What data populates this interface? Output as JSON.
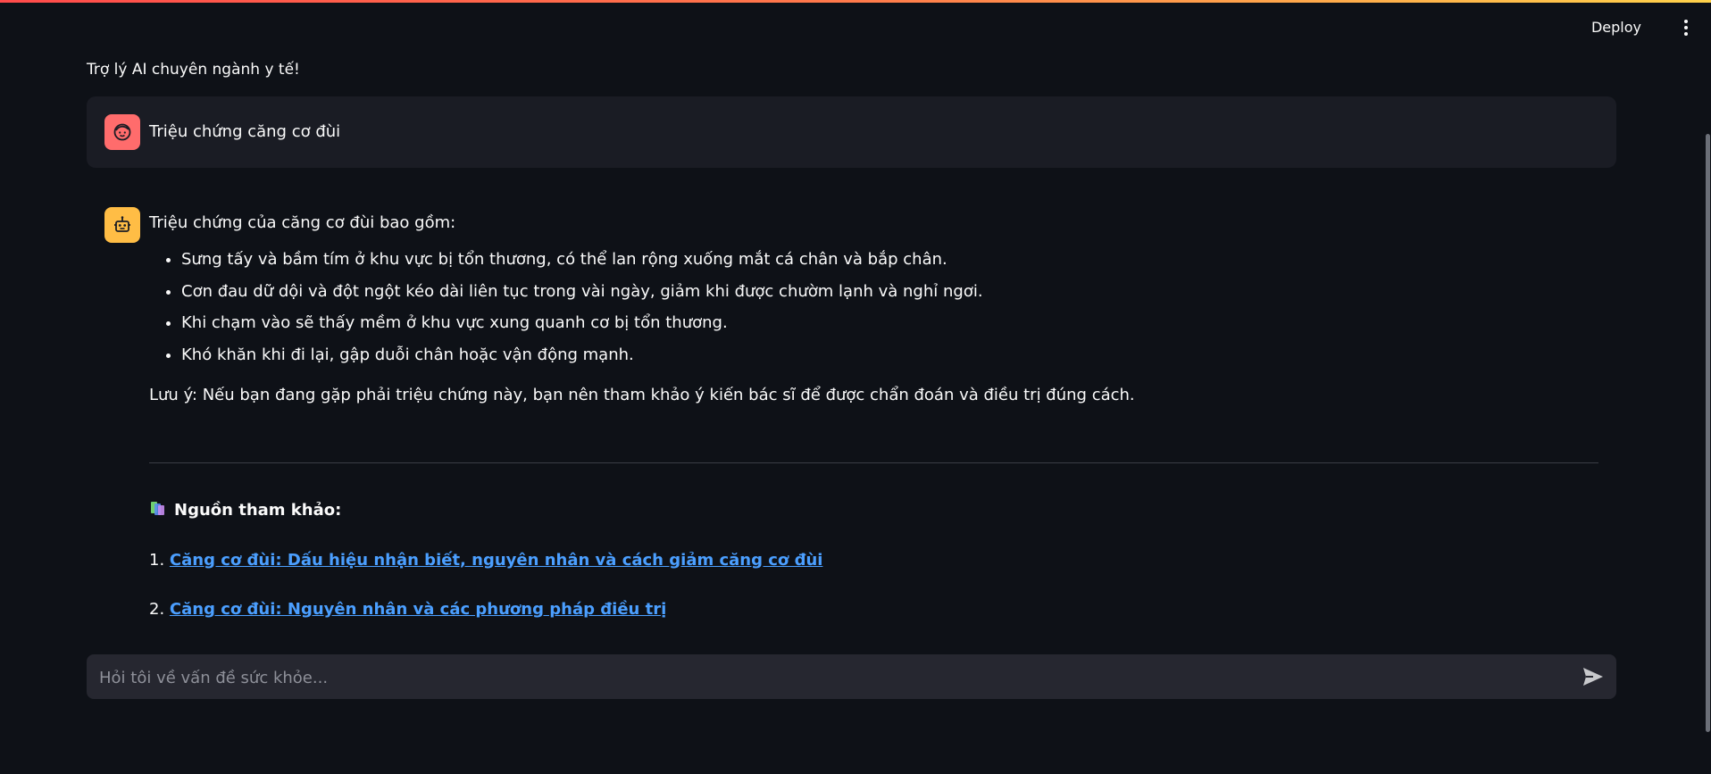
{
  "header": {
    "deploy_label": "Deploy",
    "menu_icon": "kebab-menu-icon"
  },
  "main": {
    "title": "Trợ lý AI chuyên ngành y tế!"
  },
  "chat": {
    "user_message": {
      "avatar_icon": "user-face-icon",
      "avatar_color": "#ff6c6c",
      "text": "Triệu chứng căng cơ đùi"
    },
    "assistant_message": {
      "avatar_icon": "robot-icon",
      "avatar_color": "#ffbd45",
      "intro": "Triệu chứng của căng cơ đùi bao gồm:",
      "symptoms": [
        "Sưng tấy và bầm tím ở khu vực bị tổn thương, có thể lan rộng xuống mắt cá chân và bắp chân.",
        "Cơn đau dữ dội và đột ngột kéo dài liên tục trong vài ngày, giảm khi được chườm lạnh và nghỉ ngơi.",
        "Khi chạm vào sẽ thấy mềm ở khu vực xung quanh cơ bị tổn thương.",
        "Khó khăn khi đi lại, gập duỗi chân hoặc vận động mạnh."
      ],
      "note": "Lưu ý: Nếu bạn đang gặp phải triệu chứng này, bạn nên tham khảo ý kiến bác sĩ để được chẩn đoán và điều trị đúng cách.",
      "sources_icon": "books-icon",
      "sources_heading": "Nguồn tham khảo:",
      "sources": [
        {
          "number": "1.",
          "title": "Căng cơ đùi: Dấu hiệu nhận biết, nguyên nhân và cách giảm căng cơ đùi"
        },
        {
          "number": "2.",
          "title": "Căng cơ đùi: Nguyên nhân và các phương pháp điều trị"
        }
      ]
    }
  },
  "input": {
    "placeholder": "Hỏi tôi về vấn đề sức khỏe...",
    "value": "",
    "send_icon": "send-icon"
  },
  "colors": {
    "background": "#0e1117",
    "user_bubble": "#1a1c24",
    "input_bg": "#262730",
    "link": "#4b9fff"
  }
}
